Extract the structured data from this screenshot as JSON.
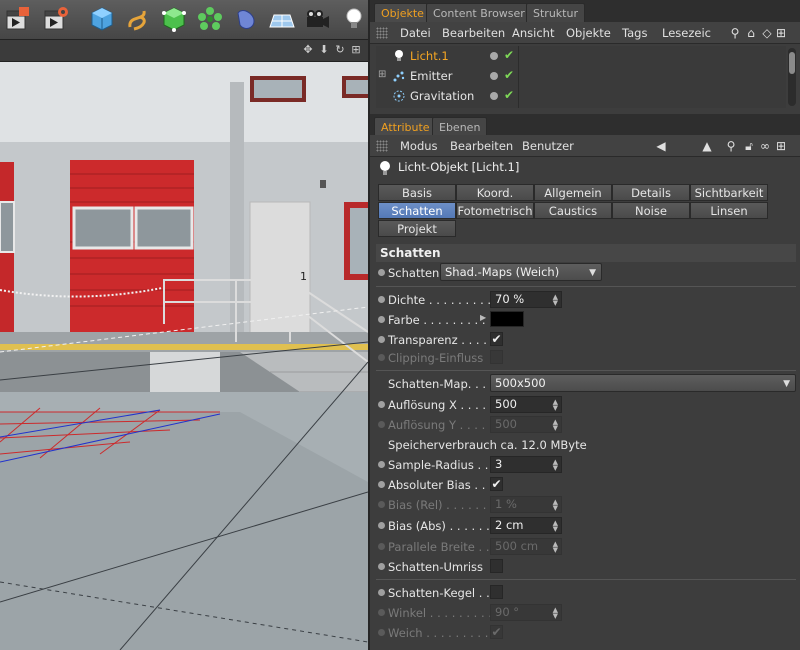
{
  "toolbar": {
    "buttons": [
      "clapper-render-icon",
      "clapper-settings-icon",
      "cube-icon",
      "spline-icon",
      "nurbs-icon",
      "array-icon",
      "deformer-icon",
      "floor-icon",
      "camera-icon",
      "light-icon"
    ]
  },
  "viewport": {
    "header_icons": [
      "move-arrows-icon",
      "down-arrow-icon",
      "rotate-icon",
      "layout-icon"
    ],
    "door_number": "1"
  },
  "objects_panel": {
    "tabs": [
      "Objekte",
      "Content Browser",
      "Struktur"
    ],
    "active_tab": "Objekte",
    "menu": [
      "Datei",
      "Bearbeiten",
      "Ansicht",
      "Objekte",
      "Tags",
      "Lesezeic"
    ],
    "items": [
      {
        "name": "Licht.1",
        "selected": true,
        "icon": "light-bulb-icon"
      },
      {
        "name": "Emitter",
        "selected": false,
        "icon": "emitter-icon"
      },
      {
        "name": "Gravitation",
        "selected": false,
        "icon": "gravitation-icon"
      }
    ]
  },
  "attributes_panel": {
    "tabs": [
      "Attribute",
      "Ebenen"
    ],
    "active_tab": "Attribute",
    "menu": [
      "Modus",
      "Bearbeiten",
      "Benutzer"
    ],
    "object_title": "Licht-Objekt [Licht.1]",
    "prop_tabs_row1": [
      "Basis",
      "Koord.",
      "Allgemein",
      "Details",
      "Sichtbarkeit"
    ],
    "prop_tabs_row2": [
      "Schatten",
      "Fotometrisch",
      "Caustics",
      "Noise",
      "Linsen"
    ],
    "prop_tabs_row3": [
      "Projekt"
    ],
    "active_prop_tab": "Schatten",
    "section_title": "Schatten",
    "schatten": {
      "label": "Schatten",
      "value": "Shad.-Maps (Weich)"
    },
    "dichte": {
      "label": "Dichte . . . . . . . . .",
      "value": "70 %"
    },
    "farbe": {
      "label": "Farbe . . . . . . . . .",
      "color": "#000000"
    },
    "transparenz": {
      "label": "Transparenz . . . .",
      "checked": "✔"
    },
    "clipping": {
      "label": "Clipping-Einfluss"
    },
    "schatten_map": {
      "label": "Schatten-Map. . .",
      "value": "500x500"
    },
    "aufloesung_x": {
      "label": "Auflösung X . . . .",
      "value": "500"
    },
    "aufloesung_y": {
      "label": "Auflösung Y . . . .",
      "value": "500"
    },
    "speicher": {
      "label": "Speicherverbrauch ca. 12.0 MByte"
    },
    "sample_radius": {
      "label": "Sample-Radius . .",
      "value": "3"
    },
    "absoluter_bias": {
      "label": "Absoluter Bias . .",
      "checked": "✔"
    },
    "bias_rel": {
      "label": "Bias (Rel) . . . . . .",
      "value": "1 %"
    },
    "bias_abs": {
      "label": "Bias (Abs) . . . . . .",
      "value": "2 cm"
    },
    "parallele_breite": {
      "label": "Parallele Breite . .",
      "value": "500 cm"
    },
    "schatten_umriss": {
      "label": "Schatten-Umriss"
    },
    "schatten_kegel": {
      "label": "Schatten-Kegel . ."
    },
    "winkel": {
      "label": "Winkel . . . . . . . . .",
      "value": "90 °"
    },
    "weich": {
      "label": "Weich . . . . . . . . . .",
      "checked": "✔"
    }
  },
  "colors": {
    "accent_orange": "#f0a020",
    "active_tab_blue": "#5479b6",
    "check_green": "#7ed957"
  }
}
